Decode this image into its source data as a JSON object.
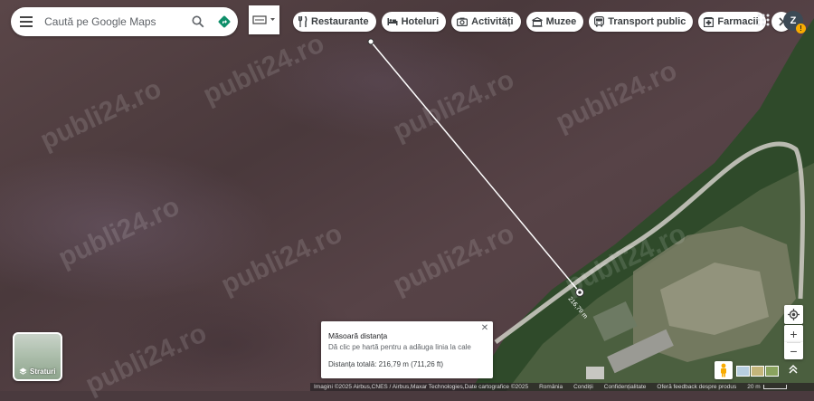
{
  "search": {
    "placeholder": "Caută pe Google Maps"
  },
  "chips": [
    {
      "label": "Restaurante",
      "icon": "cutlery-icon"
    },
    {
      "label": "Hoteluri",
      "icon": "bed-icon"
    },
    {
      "label": "Activități",
      "icon": "camera-icon"
    },
    {
      "label": "Muzee",
      "icon": "museum-icon"
    },
    {
      "label": "Transport public",
      "icon": "bus-icon"
    },
    {
      "label": "Farmacii",
      "icon": "pharmacy-icon"
    }
  ],
  "account": {
    "initial": "Z",
    "warning": "!"
  },
  "measurement": {
    "title": "Măsoară distanța",
    "hint": "Dă clic pe hartă pentru a adăuga linia la cale",
    "total": "Distanța totală: 216,79 m (711,26 ft)",
    "segment_label": "216,79 m"
  },
  "layers": {
    "label": "Straturi"
  },
  "zoom": {
    "in": "+",
    "out": "−"
  },
  "watermark": "publi24.ro",
  "footer": {
    "imagery": "Imagini ©2025 Airbus,CNES / Airbus,Maxar Technologies,Date cartografice ©2025",
    "country": "România",
    "terms": "Condiții",
    "privacy": "Confidențialitate",
    "feedback": "Oferă feedback despre produs",
    "scale": "20 m"
  },
  "colors": {
    "field": "#4d3b3e",
    "vegetation": "#2f4a2a",
    "road": "#c9c7bf",
    "accent": "#1a73e8"
  }
}
